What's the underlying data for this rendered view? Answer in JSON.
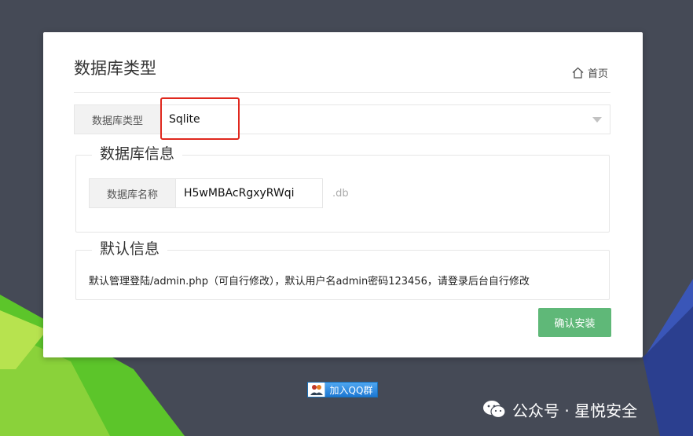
{
  "card": {
    "title": "数据库类型",
    "home_label": "首页"
  },
  "db_type": {
    "label": "数据库类型",
    "selected": "Sqlite"
  },
  "db_info": {
    "legend": "数据库信息",
    "name_label": "数据库名称",
    "name_value": "H5wMBAcRgxyRWqi",
    "suffix": ".db"
  },
  "default_info": {
    "legend": "默认信息",
    "text": "默认管理登陆/admin.php（可自行修改），默认用户名admin密码123456，请登录后台自行修改"
  },
  "confirm_label": "确认安装",
  "qq_badge_label": "加入QQ群",
  "watermark": {
    "text": "公众号 · 星悦安全"
  },
  "colors": {
    "background": "#454a56",
    "accent_green": "#5fb878",
    "highlight_red": "#e0281e",
    "qq_blue": "#1d78d3"
  }
}
